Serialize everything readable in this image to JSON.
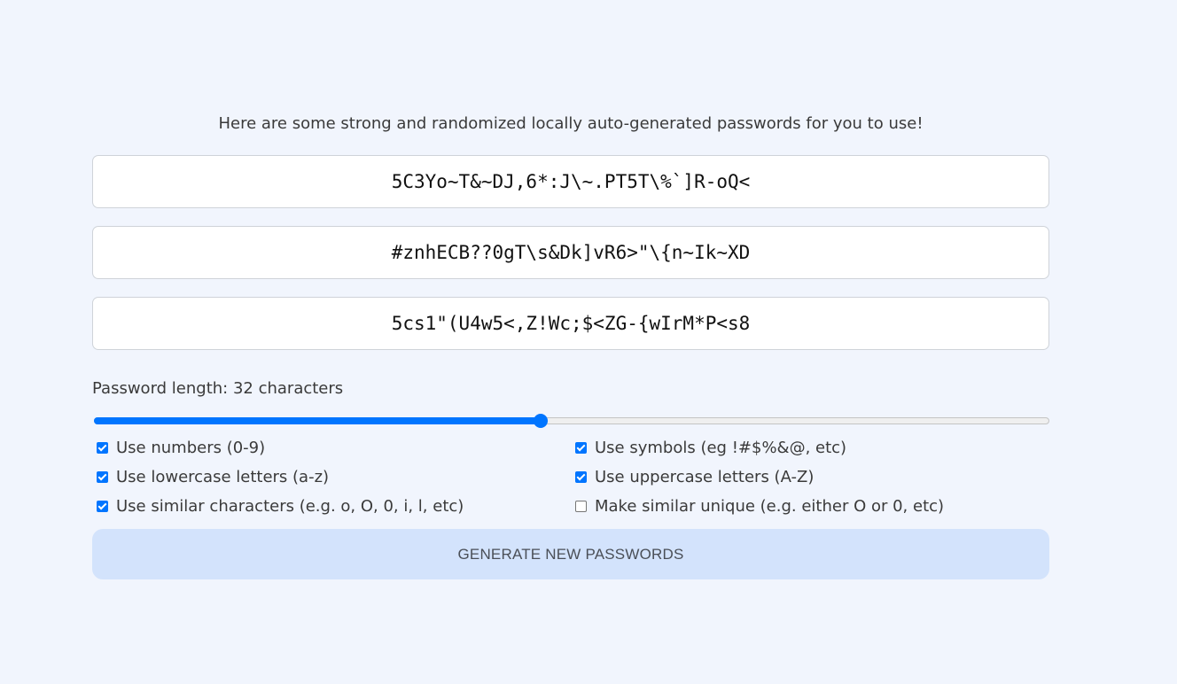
{
  "intro_text": "Here are some strong and randomized locally auto-generated passwords for you to use!",
  "passwords": [
    "5C3Yo~T&~DJ,6*:J\\~.PT5T\\%`]R-oQ<",
    "#znhECB??0gT\\s&Dk]vR6>\"\\{n~Ik~XD",
    "5cs1\"(U4w5<,Z!Wc;$<ZG-{wIrM*P<s8"
  ],
  "length": {
    "label": "Password length: 32 characters",
    "value": 32,
    "min": 4,
    "max": 64
  },
  "options": [
    {
      "label": "Use numbers (0-9)",
      "checked": true
    },
    {
      "label": "Use symbols (eg !#$%&@, etc)",
      "checked": true
    },
    {
      "label": "Use lowercase letters (a-z)",
      "checked": true
    },
    {
      "label": "Use uppercase letters (A-Z)",
      "checked": true
    },
    {
      "label": "Use similar characters (e.g. o, O, 0, i, l, etc)",
      "checked": true
    },
    {
      "label": "Make similar unique (e.g. either O or 0, etc)",
      "checked": false
    }
  ],
  "generate_label": "GENERATE NEW PASSWORDS",
  "colors": {
    "background": "#f1f5fd",
    "accent": "#0075ff",
    "button_bg": "#d3e3fc"
  }
}
